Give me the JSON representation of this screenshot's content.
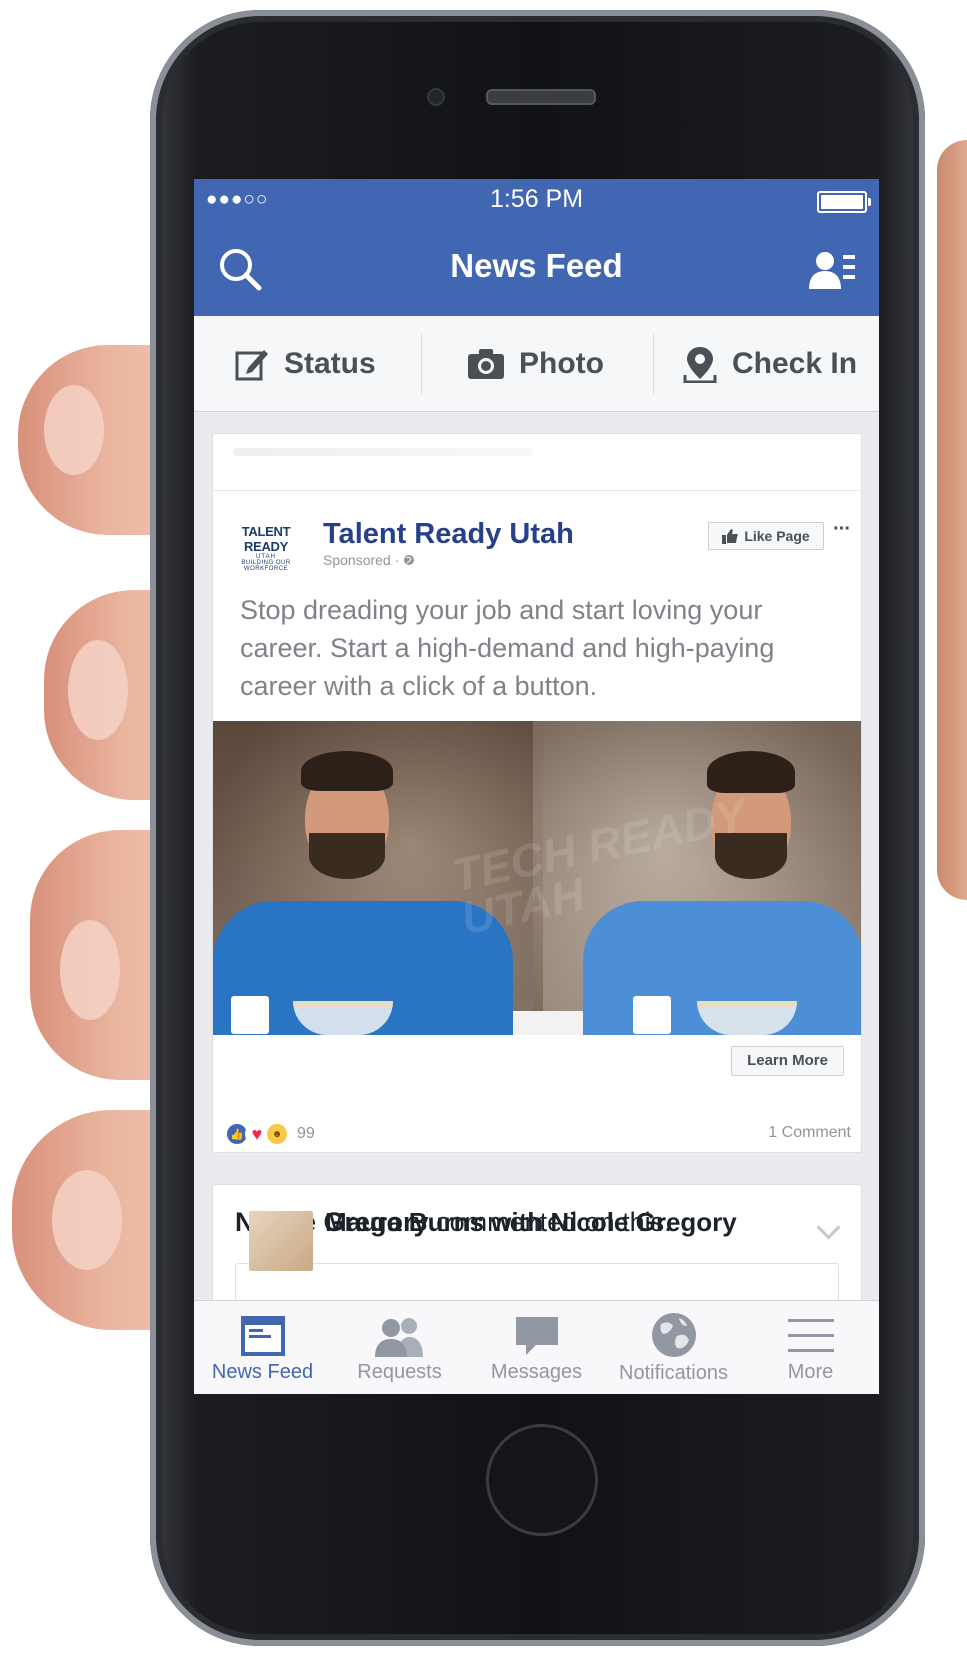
{
  "status_bar": {
    "signal": "●●●○○",
    "time": "1:56 PM"
  },
  "header": {
    "title": "News Feed"
  },
  "composer": {
    "status_label": "Status",
    "photo_label": "Photo",
    "checkin_label": "Check In"
  },
  "post": {
    "logo": {
      "line1": "TALENT READY",
      "line2": "UTAH",
      "line3": "BUILDING OUR WORKFORCE"
    },
    "page_name": "Talent Ready Utah",
    "sponsored": "Sponsored · ",
    "like_page_label": "Like Page",
    "more_label": "···",
    "text": "Stop dreading your job and start loving your career. Start a high-demand and high-paying career with a click of a button.",
    "watermark": "TECH READY UTAH",
    "learn_more_label": "Learn More",
    "reaction_count": "99",
    "comments_label": "1 Comment"
  },
  "activity": {
    "actor": "Nicole Gregory",
    "action": " commented on this.",
    "inner_name": "Maura Burns with Nicole Gregory"
  },
  "tabs": [
    {
      "label": "News Feed",
      "icon": "news-feed-icon",
      "active": true
    },
    {
      "label": "Requests",
      "icon": "friend-requests-icon",
      "active": false
    },
    {
      "label": "Messages",
      "icon": "messages-icon",
      "active": false
    },
    {
      "label": "Notifications",
      "icon": "globe-icon",
      "active": false
    },
    {
      "label": "More",
      "icon": "menu-icon",
      "active": false
    }
  ],
  "colors": {
    "brand": "#4267b2",
    "page_name": "#27408b",
    "muted": "#90949c"
  }
}
